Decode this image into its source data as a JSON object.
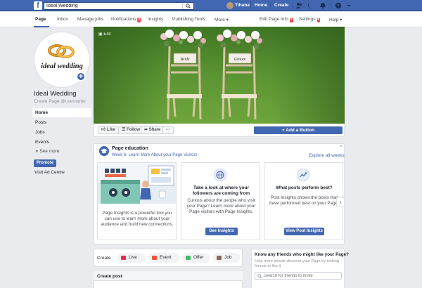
{
  "topbar": {
    "search_value": "Ideal Wedding",
    "user_name": "Tihana",
    "home_label": "Home",
    "create_label": "Create"
  },
  "pagenav": {
    "items": [
      {
        "label": "Page",
        "active": true
      },
      {
        "label": "Inbox"
      },
      {
        "label": "Manage jobs"
      },
      {
        "label": "Notifications",
        "badge": "2"
      },
      {
        "label": "Insights"
      },
      {
        "label": "Publishing Tools"
      },
      {
        "label": "More ▾"
      }
    ],
    "right": [
      {
        "label": "Edit Page Info",
        "badge": "9"
      },
      {
        "label": "Settings",
        "badge": "8"
      },
      {
        "label": "Help ▾"
      }
    ]
  },
  "profile": {
    "logo_text": "ideal wedding",
    "page_name": "Ideal Wedding",
    "username": "Create Page @username"
  },
  "sidebar": {
    "items": [
      "Home",
      "Posts",
      "Jobs",
      "Events"
    ],
    "see_more": "See more",
    "promote": "Promote",
    "visit_ad": "Visit Ad Centre"
  },
  "cover": {
    "camera_label": "Edit",
    "sign_left": "Bride",
    "sign_right": "Groom"
  },
  "actions": {
    "like": "Like",
    "follow": "Follow",
    "share": "Share",
    "more": "···",
    "add_button": "+ Add a Button"
  },
  "education": {
    "title": "Page education",
    "subtitle": "Week 6: Learn More About your Page Visitors",
    "explore": "Explore all weeks",
    "close": "×",
    "cards": [
      {
        "text": "Page Insights is a powerful tool you can use to learn more about your audience and build new connections."
      },
      {
        "title": "Take a look at where your followers are coming from",
        "text": "Curious about the people who visit your Page? Learn more about your Page visitors with Page Insights.",
        "button": "See Insights"
      },
      {
        "title": "What posts perform best?",
        "text": "Post Insights shows the posts that have performed best on your Page.",
        "button": "View Post Insights"
      }
    ],
    "next": "›"
  },
  "create": {
    "label": "Create",
    "pills": [
      {
        "label": "Live",
        "color": "#f02849"
      },
      {
        "label": "Event",
        "color": "#f5533d"
      },
      {
        "label": "Offer",
        "color": "#45bd62"
      },
      {
        "label": "Job",
        "color": "#8c6b4f"
      }
    ],
    "post_label": "Create post"
  },
  "friends": {
    "title": "Know any friends who might like your Page?",
    "sub": "Help more people discover your Page by inviting friends to like it",
    "search_placeholder": "Search for friends to invite"
  }
}
